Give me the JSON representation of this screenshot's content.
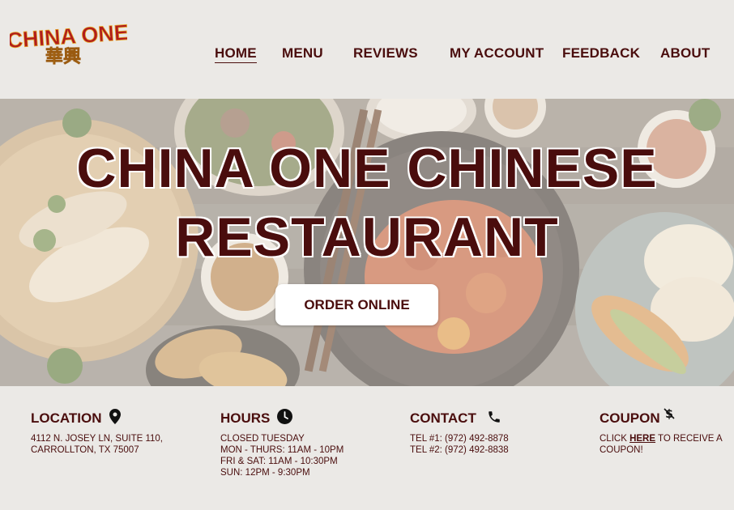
{
  "brand": {
    "name": "CHINA ONE",
    "chinese": "華興"
  },
  "nav": [
    {
      "label": "HOME",
      "active": true
    },
    {
      "label": "MENU"
    },
    {
      "label": "REVIEWS"
    },
    {
      "label": "MY ACCOUNT"
    },
    {
      "label": "FEEDBACK"
    },
    {
      "label": "ABOUT"
    }
  ],
  "hero": {
    "title_line1": "CHINA ONE CHINESE",
    "title_line2": "RESTAURANT",
    "order_label": "ORDER ONLINE"
  },
  "info": {
    "location": {
      "heading": "LOCATION",
      "icon": "map-pin-icon",
      "lines": [
        "4112 N. JOSEY LN, SUITE 110,",
        "CARROLLTON, TX 75007"
      ]
    },
    "hours": {
      "heading": "HOURS",
      "icon": "clock-icon",
      "lines": [
        "CLOSED TUESDAY",
        "MON - THURS: 11AM - 10PM",
        "FRI & SAT: 11AM - 10:30PM",
        "SUN: 12PM - 9:30PM"
      ]
    },
    "contact": {
      "heading": "CONTACT",
      "icon": "phone-icon",
      "lines": [
        "TEL #1: (972) 492-8878",
        "TEL #2: (972) 492-8838"
      ]
    },
    "coupon": {
      "heading": "COUPON",
      "icon": "no-dollar-icon",
      "prefix": "CLICK ",
      "link": "HERE",
      "suffix": " TO RECEIVE A",
      "line2": "COUPON!"
    }
  },
  "colors": {
    "brand": "#4a0d0d",
    "background": "#ebe9e6",
    "logo_red": "#b01c1c",
    "logo_gold": "#e6a82a"
  }
}
